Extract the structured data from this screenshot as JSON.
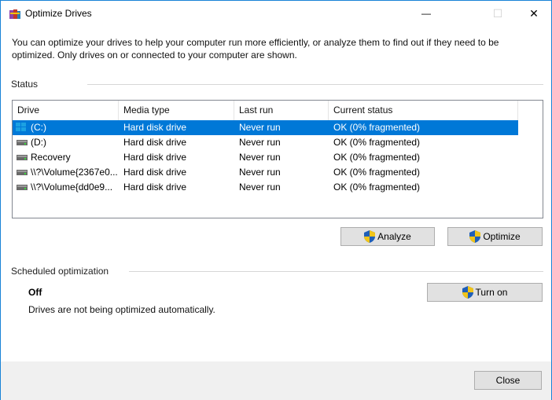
{
  "window": {
    "title": "Optimize Drives",
    "minimize_glyph": "—",
    "maximize_glyph": "☐",
    "close_glyph": "✕"
  },
  "intro_text": "You can optimize your drives to help your computer run more efficiently, or analyze them to find out if they need to be optimized. Only drives on or connected to your computer are shown.",
  "status": {
    "label": "Status",
    "columns": [
      "Drive",
      "Media type",
      "Last run",
      "Current status"
    ],
    "rows": [
      {
        "drive": "(C:)",
        "media": "Hard disk drive",
        "last_run": "Never run",
        "status": "OK (0% fragmented)",
        "icon": "windows-drive-icon",
        "selected": true
      },
      {
        "drive": "(D:)",
        "media": "Hard disk drive",
        "last_run": "Never run",
        "status": "OK (0% fragmented)",
        "icon": "drive-icon",
        "selected": false
      },
      {
        "drive": "Recovery",
        "media": "Hard disk drive",
        "last_run": "Never run",
        "status": "OK (0% fragmented)",
        "icon": "drive-icon",
        "selected": false
      },
      {
        "drive": "\\\\?\\Volume{2367e0...",
        "media": "Hard disk drive",
        "last_run": "Never run",
        "status": "OK (0% fragmented)",
        "icon": "drive-icon",
        "selected": false
      },
      {
        "drive": "\\\\?\\Volume{dd0e9...",
        "media": "Hard disk drive",
        "last_run": "Never run",
        "status": "OK (0% fragmented)",
        "icon": "drive-icon",
        "selected": false
      }
    ],
    "analyze_label": "Analyze",
    "optimize_label": "Optimize"
  },
  "scheduled": {
    "label": "Scheduled optimization",
    "state": "Off",
    "description": "Drives are not being optimized automatically.",
    "turn_on_label": "Turn on"
  },
  "footer": {
    "close_label": "Close"
  },
  "colors": {
    "selection": "#0078d7",
    "button_face": "#e1e1e1",
    "footer_bg": "#f0f0f0"
  }
}
